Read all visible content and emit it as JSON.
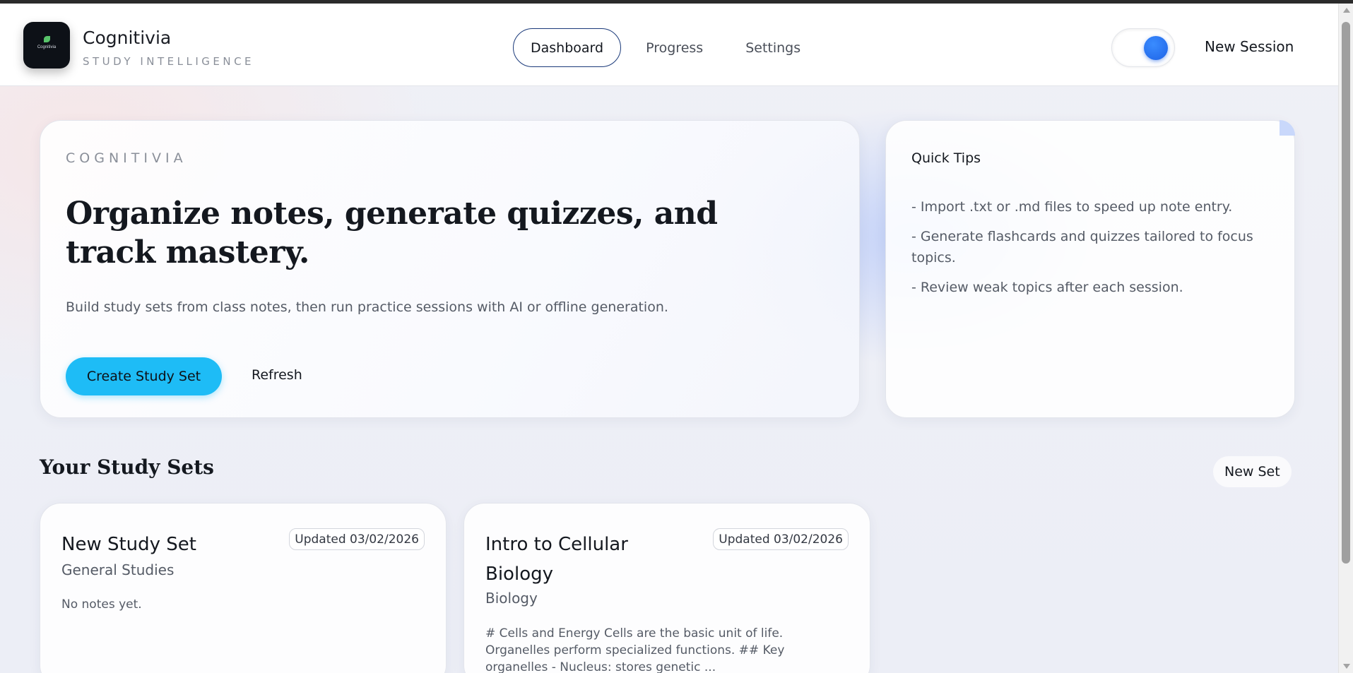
{
  "header": {
    "logo_text": "Cognitivia",
    "brand_title": "Cognitivia",
    "brand_subtitle": "STUDY INTELLIGENCE",
    "nav": [
      {
        "label": "Dashboard",
        "active": true
      },
      {
        "label": "Progress",
        "active": false
      },
      {
        "label": "Settings",
        "active": false
      }
    ],
    "theme_toggle_on": true,
    "new_session_label": "New Session"
  },
  "hero": {
    "eyebrow": "COGNITIVIA",
    "title": "Organize notes, generate quizzes, and track mastery.",
    "description": "Build study sets from class notes, then run practice sessions with AI or offline generation.",
    "primary_button": "Create Study Set",
    "secondary_button": "Refresh"
  },
  "tips": {
    "title": "Quick Tips",
    "items": [
      "- Import .txt or .md files to speed up note entry.",
      "- Generate flashcards and quizzes tailored to focus topics.",
      "- Review weak topics after each session."
    ]
  },
  "study_sets": {
    "section_title": "Your Study Sets",
    "new_set_label": "New Set",
    "sets": [
      {
        "title": "New Study Set",
        "updated": "Updated 03/02/2026",
        "subject": "General Studies",
        "notes": "No notes yet."
      },
      {
        "title": "Intro to Cellular Biology",
        "updated": "Updated 03/02/2026",
        "subject": "Biology",
        "notes": "# Cells and Energy Cells are the basic unit of life. Organelles perform specialized functions. ## Key organelles - Nucleus: stores genetic ..."
      }
    ]
  },
  "colors": {
    "accent": "#1ebcf6",
    "toggle": "#1e63e6",
    "nav_active_border": "#1b3a7a"
  }
}
